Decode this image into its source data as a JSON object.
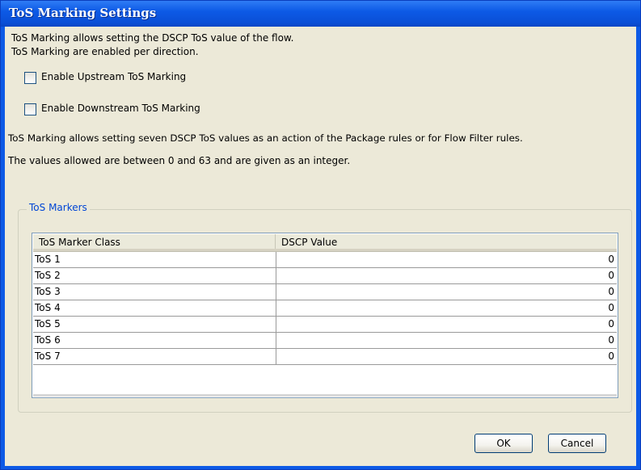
{
  "window": {
    "title": "ToS Marking Settings"
  },
  "intro": {
    "line1": "ToS Marking allows setting the DSCP ToS value of the flow.",
    "line2": "ToS Marking are enabled per direction."
  },
  "checkboxes": [
    {
      "label": "Enable Upstream ToS Marking",
      "checked": false
    },
    {
      "label": "Enable Downstream ToS Marking",
      "checked": false
    }
  ],
  "description": {
    "line1": "ToS Marking allows setting seven DSCP ToS values as an action of the Package rules or for Flow Filter rules.",
    "line2": "The values allowed are between 0 and 63 and are given as an integer."
  },
  "markers": {
    "group_label": "ToS Markers",
    "columns": [
      "ToS Marker Class",
      "DSCP Value"
    ],
    "rows": [
      {
        "name": "ToS 1",
        "value": "0"
      },
      {
        "name": "ToS 2",
        "value": "0"
      },
      {
        "name": "ToS 3",
        "value": "0"
      },
      {
        "name": "ToS 4",
        "value": "0"
      },
      {
        "name": "ToS 5",
        "value": "0"
      },
      {
        "name": "ToS 6",
        "value": "0"
      },
      {
        "name": "ToS 7",
        "value": "0"
      }
    ]
  },
  "buttons": {
    "ok": "OK",
    "cancel": "Cancel"
  }
}
